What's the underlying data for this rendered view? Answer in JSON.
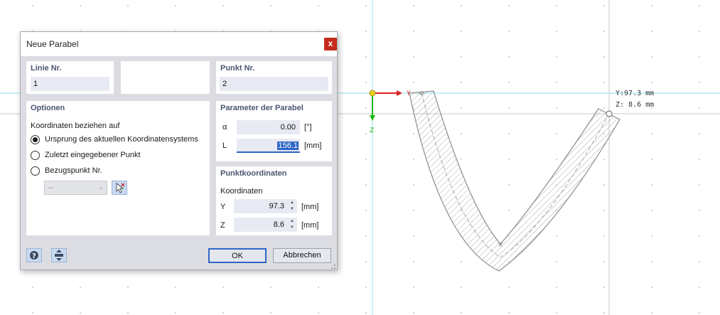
{
  "dialog": {
    "title": "Neue Parabel",
    "close_label": "x",
    "line_no": {
      "title": "Linie Nr.",
      "value": "1"
    },
    "point_no": {
      "title": "Punkt Nr.",
      "value": "2"
    },
    "options": {
      "title": "Optionen",
      "subtitle": "Koordinaten beziehen auf",
      "radios": [
        {
          "label": "Ursprung des aktuellen Koordinatensystems",
          "selected": true
        },
        {
          "label": "Zuletzt eingegebener Punkt",
          "selected": false
        },
        {
          "label": "Bezugspunkt Nr.",
          "selected": false
        }
      ],
      "ref_select_value": "--"
    },
    "parabola": {
      "title": "Parameter der Parabel",
      "alpha": {
        "label": "α",
        "value": "0.00",
        "unit": "[°]"
      },
      "l": {
        "label": "L",
        "value": "156.1",
        "unit": "[mm]"
      }
    },
    "point_coords": {
      "title": "Punktkoordinaten",
      "subtitle": "Koordinaten",
      "y": {
        "label": "Y",
        "value": "97.3",
        "unit": "[mm]"
      },
      "z": {
        "label": "Z",
        "value": "8.6",
        "unit": "[mm]"
      }
    },
    "buttons": {
      "ok": "OK",
      "cancel": "Abbrechen"
    }
  },
  "viewport": {
    "axis_y_label": "Y",
    "axis_z_label": "Z",
    "readout_y": "Y:97.3 mm",
    "readout_z": "Z: 8.6 mm"
  },
  "colors": {
    "accent": "#2f66c6",
    "close": "#c42b1c",
    "axis_y": "#e02020",
    "axis_z": "#18b818",
    "guide": "#7fdcf0"
  }
}
